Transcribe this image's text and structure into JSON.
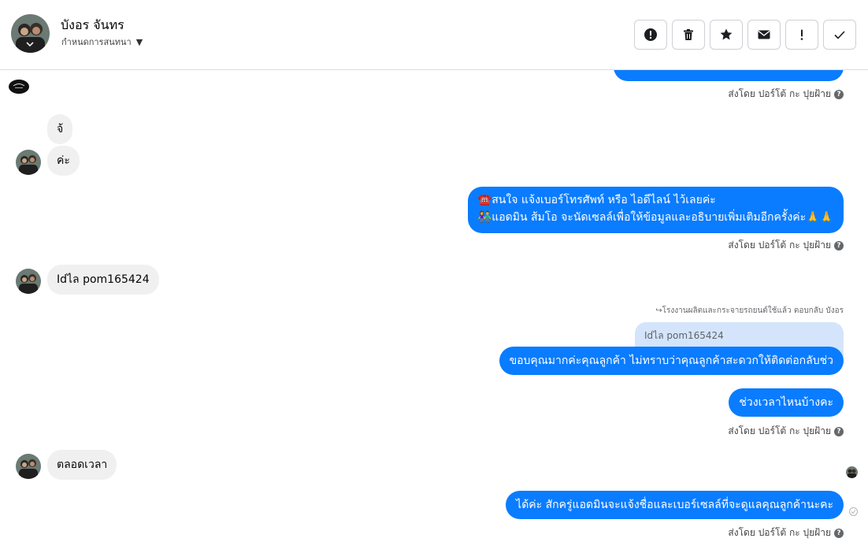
{
  "header": {
    "contact_name": "บังอร จันทร",
    "subtitle": "กำหนดการสนทนา",
    "actions": [
      {
        "name": "alert-circle-icon",
        "icon": "alert"
      },
      {
        "name": "trash-icon",
        "icon": "trash"
      },
      {
        "name": "star-icon",
        "icon": "star"
      },
      {
        "name": "mail-icon",
        "icon": "mail"
      },
      {
        "name": "exclamation-icon",
        "icon": "exclamation"
      },
      {
        "name": "check-icon",
        "icon": "check"
      }
    ]
  },
  "messages": {
    "sent_by": "ส่งโดย ปอร์โต้ กะ ปุยฝ้าย",
    "in_1": "จ้",
    "in_2": "ค่ะ",
    "out_1_line1": "☎️สนใจ แจ้งเบอร์โทรศัพท์ หรือ ไอดีไลน์  ไว้เลยค่ะ",
    "out_1_line2": "👫แอดมิน ส้มโอ จะนัดเซลล์เพื่อให้ข้อมูลและอธิบายเพิ่มเติมอีกครั้งค่ะ🙏🙏",
    "in_3": "Idไล pom165424",
    "reply_meta": "↪โรงงานผลิตและกระจายรถยนต์ใช้แล้ว ตอบกลับ บังอร",
    "reply_quote": "Idไล pom165424",
    "out_2": "ขอบคุณมากค่ะคุณลูกค้า ไม่ทราบว่าคุณลูกค้าสะดวกให้ติดต่อกลับช่ว",
    "out_3": "ช่วงเวลาไหนบ้างคะ",
    "in_4": "ตลอดเวลา",
    "out_4": "ได้ค่ะ สักครู่แอดมินจะแจ้งชื่อและเบอร์เซลล์ที่จะดูแลคุณลูกค้านะคะ"
  },
  "colors": {
    "outgoing_bubble": "#0a7cff",
    "incoming_bubble": "#f0f0f0"
  }
}
